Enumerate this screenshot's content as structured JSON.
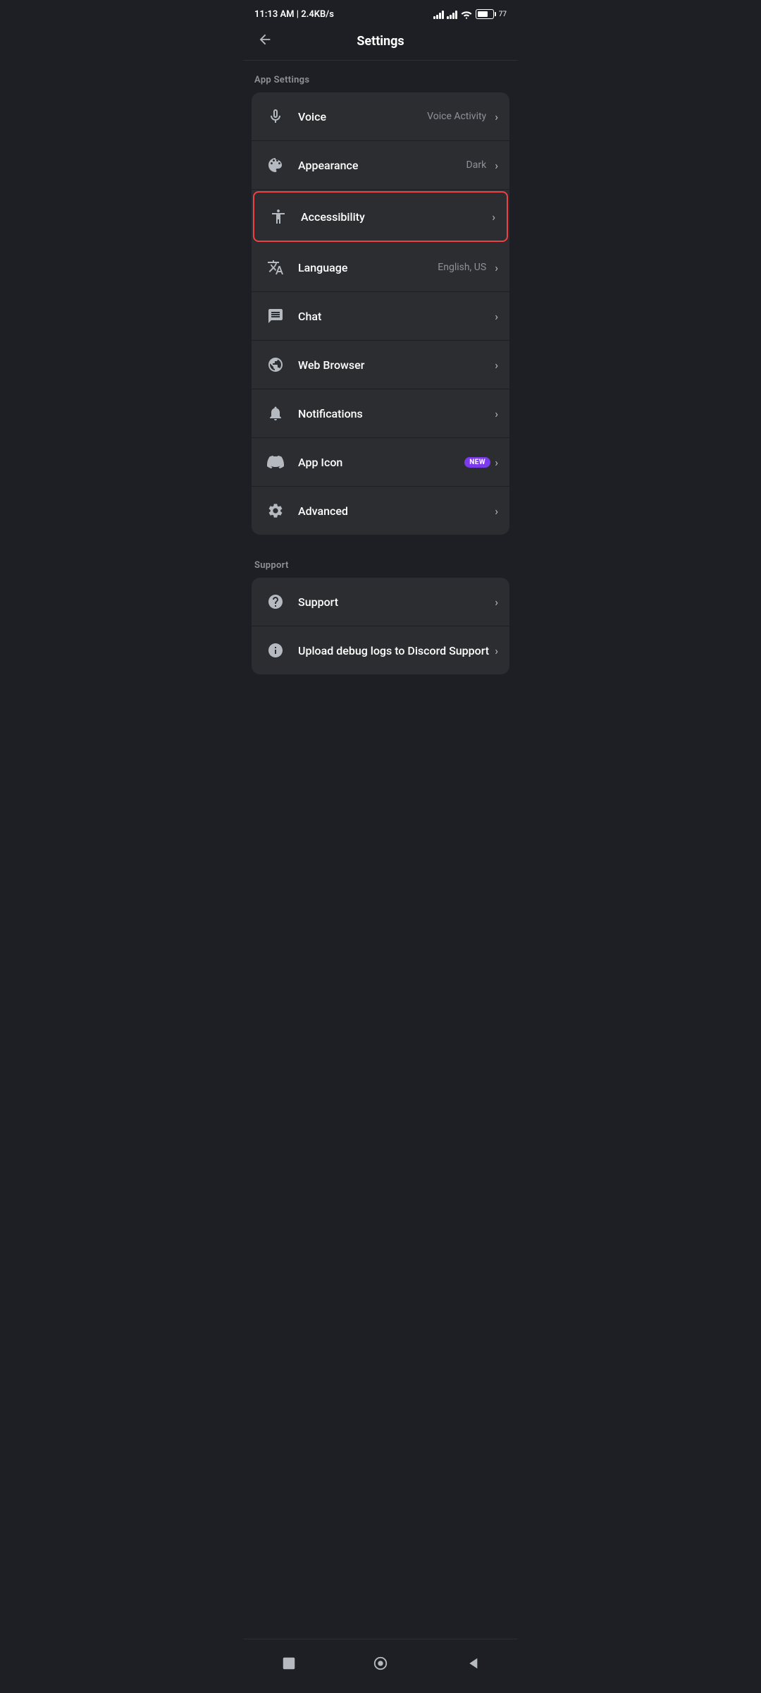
{
  "status_bar": {
    "time": "11:13 AM | 2.4KB/s",
    "battery_level": "77"
  },
  "header": {
    "title": "Settings",
    "back_label": "←"
  },
  "app_settings": {
    "section_label": "App Settings",
    "items": [
      {
        "id": "voice",
        "label": "Voice",
        "value": "Voice Activity",
        "icon": "microphone",
        "new_badge": false
      },
      {
        "id": "appearance",
        "label": "Appearance",
        "value": "Dark",
        "icon": "palette",
        "new_badge": false
      },
      {
        "id": "accessibility",
        "label": "Accessibility",
        "value": "",
        "icon": "accessibility",
        "new_badge": false,
        "highlighted": true
      },
      {
        "id": "language",
        "label": "Language",
        "value": "English, US",
        "icon": "language",
        "new_badge": false
      },
      {
        "id": "chat",
        "label": "Chat",
        "value": "",
        "icon": "chat",
        "new_badge": false
      },
      {
        "id": "web-browser",
        "label": "Web Browser",
        "value": "",
        "icon": "globe",
        "new_badge": false
      },
      {
        "id": "notifications",
        "label": "Notifications",
        "value": "",
        "icon": "bell",
        "new_badge": false
      },
      {
        "id": "app-icon",
        "label": "App Icon",
        "value": "",
        "icon": "discord",
        "new_badge": true
      },
      {
        "id": "advanced",
        "label": "Advanced",
        "value": "",
        "icon": "gear",
        "new_badge": false
      }
    ]
  },
  "support": {
    "section_label": "Support",
    "items": [
      {
        "id": "support",
        "label": "Support",
        "value": "",
        "icon": "question"
      },
      {
        "id": "upload-debug-logs",
        "label": "Upload debug logs to Discord Support",
        "value": "",
        "icon": "info"
      }
    ]
  },
  "new_badge_label": "NEW",
  "nav": {
    "square_label": "■",
    "circle_label": "●",
    "triangle_label": "◀"
  }
}
